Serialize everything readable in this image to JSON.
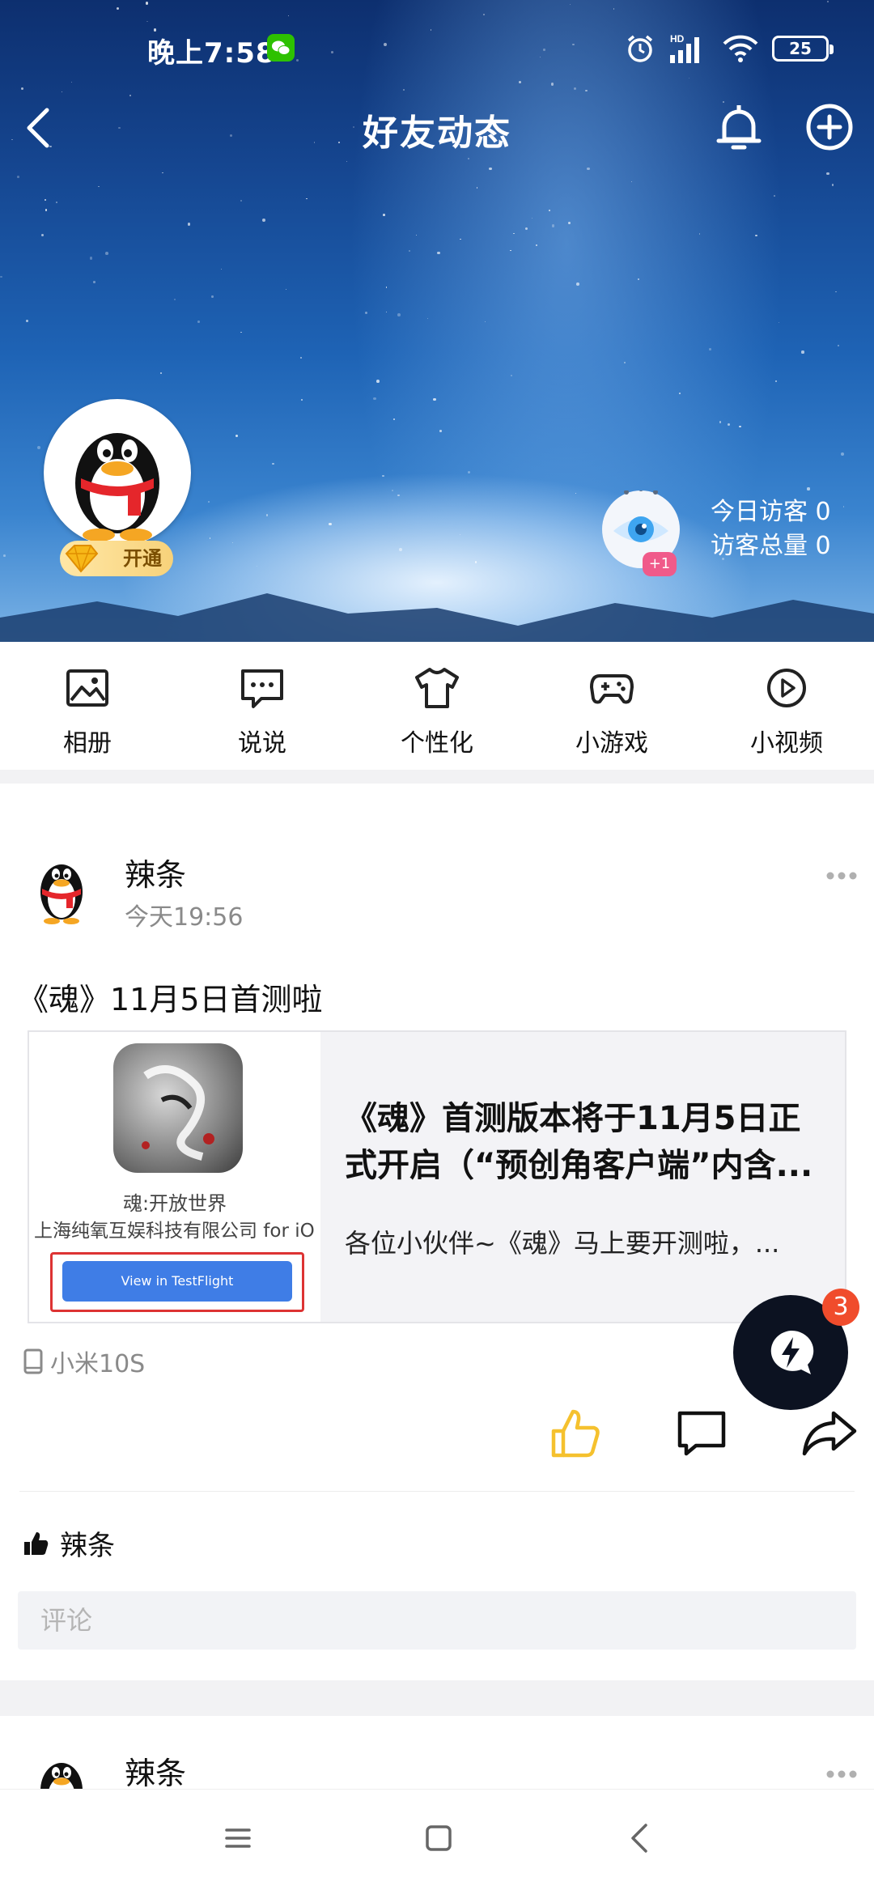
{
  "status_bar": {
    "time": "晚上7:58",
    "battery": "25",
    "network": "HD"
  },
  "nav": {
    "title": "好友动态"
  },
  "profile": {
    "open_badge": "开通",
    "eye_plus": "+1",
    "today_visitors": "今日访客 0",
    "total_visitors": "访客总量 0"
  },
  "menu": [
    {
      "label": "相册",
      "icon": "photo-album-icon"
    },
    {
      "label": "说说",
      "icon": "chat-bubble-icon"
    },
    {
      "label": "个性化",
      "icon": "tshirt-icon"
    },
    {
      "label": "小游戏",
      "icon": "gamepad-icon"
    },
    {
      "label": "小视频",
      "icon": "video-play-icon"
    }
  ],
  "post": {
    "author": "辣条",
    "time": "今天19:56",
    "text": "《魂》11月5日首测啦",
    "share": {
      "game_name": "魂:开放世界",
      "company": "上海纯氧互娱科技有限公司 for iO",
      "button": "View in TestFlight",
      "title": "《魂》首测版本将于11月5日正式开启（“预创角客户端”内含...",
      "desc": "各位小伙伴~《魂》马上要开测啦，..."
    },
    "device": "小米10S",
    "liked_by": "辣条",
    "comment_placeholder": "评论"
  },
  "fab": {
    "badge": "3"
  },
  "post2": {
    "author": "辣条"
  },
  "colors": {
    "like_active": "#F5C12E",
    "fab_bg": "#0C1221",
    "badge_red": "#F04C2C"
  }
}
